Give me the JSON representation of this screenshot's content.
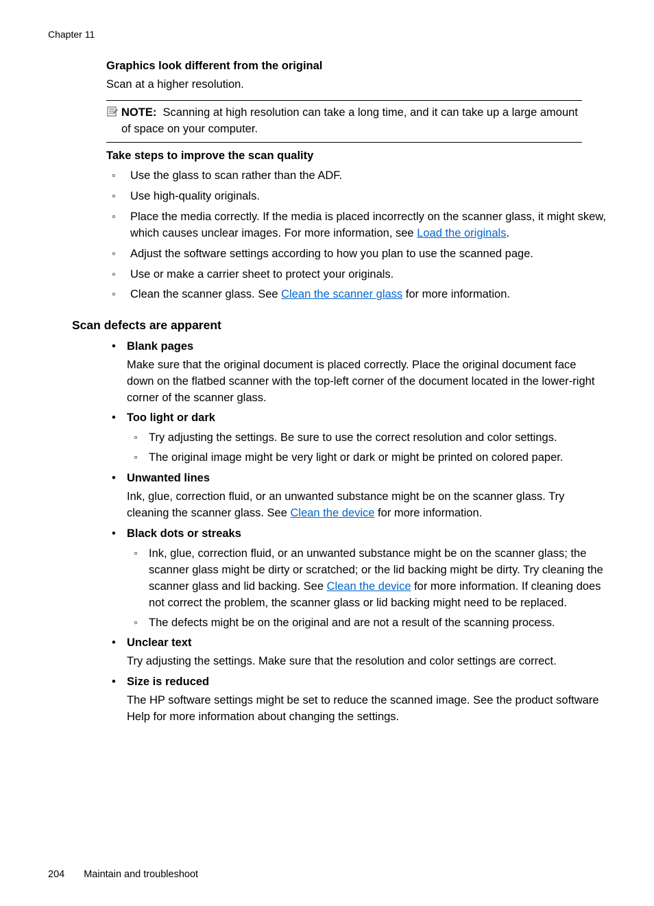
{
  "chapter": "Chapter 11",
  "sec1": {
    "title": "Graphics look different from the original",
    "text": "Scan at a higher resolution.",
    "note_label": "NOTE:",
    "note_text": "Scanning at high resolution can take a long time, and it can take up a large amount of space on your computer."
  },
  "sec2": {
    "title": "Take steps to improve the scan quality",
    "items": {
      "i1": "Use the glass to scan rather than the ADF.",
      "i2": "Use high-quality originals.",
      "i3a": "Place the media correctly. If the media is placed incorrectly on the scanner glass, it might skew, which causes unclear images. For more information, see ",
      "i3link": "Load the originals",
      "i3b": ".",
      "i4": "Adjust the software settings according to how you plan to use the scanned page.",
      "i5": "Use or make a carrier sheet to protect your originals.",
      "i6a": "Clean the scanner glass. See ",
      "i6link": "Clean the scanner glass",
      "i6b": " for more information."
    }
  },
  "heading2": "Scan defects are apparent",
  "defects": {
    "blank": {
      "title": "Blank pages",
      "text": "Make sure that the original document is placed correctly. Place the original document face down on the flatbed scanner with the top-left corner of the document located in the lower-right corner of the scanner glass."
    },
    "light": {
      "title": "Too light or dark",
      "s1": "Try adjusting the settings. Be sure to use the correct resolution and color settings.",
      "s2": "The original image might be very light or dark or might be printed on colored paper."
    },
    "unwanted": {
      "title": "Unwanted lines",
      "text_a": "Ink, glue, correction fluid, or an unwanted substance might be on the scanner glass. Try cleaning the scanner glass. See ",
      "link": "Clean the device",
      "text_b": " for more information."
    },
    "black": {
      "title": "Black dots or streaks",
      "s1a": "Ink, glue, correction fluid, or an unwanted substance might be on the scanner glass; the scanner glass might be dirty or scratched; or the lid backing might be dirty. Try cleaning the scanner glass and lid backing. See ",
      "s1link": "Clean the device",
      "s1b": " for more information. If cleaning does not correct the problem, the scanner glass or lid backing might need to be replaced.",
      "s2": "The defects might be on the original and are not a result of the scanning process."
    },
    "unclear": {
      "title": "Unclear text",
      "text": "Try adjusting the settings. Make sure that the resolution and color settings are correct."
    },
    "size": {
      "title": "Size is reduced",
      "text": "The HP software settings might be set to reduce the scanned image. See the product software Help for more information about changing the settings."
    }
  },
  "footer": {
    "page": "204",
    "section": "Maintain and troubleshoot"
  }
}
